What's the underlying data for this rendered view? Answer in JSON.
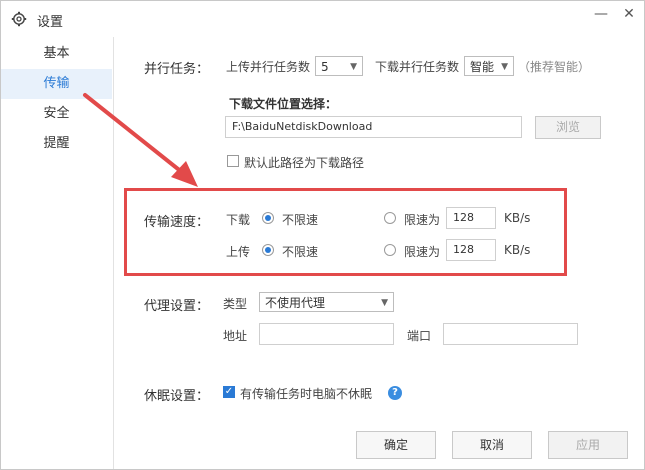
{
  "window": {
    "title": "设置",
    "minimize": "—",
    "close": "✕"
  },
  "sidebar": {
    "items": [
      {
        "label": "基本"
      },
      {
        "label": "传输"
      },
      {
        "label": "安全"
      },
      {
        "label": "提醒"
      }
    ],
    "active": "传输"
  },
  "parallel": {
    "section_label": "并行任务：",
    "upload_label": "上传并行任务数",
    "upload_value": "5",
    "download_label": "下载并行任务数",
    "download_value": "智能",
    "recommend_hint": "（推荐智能）"
  },
  "download_location": {
    "label": "下载文件位置选择：",
    "path": "F:\\BaiduNetdiskDownload",
    "browse_label": "浏览",
    "default_checkbox_label": "默认此路径为下载路径",
    "default_checked": false
  },
  "speed": {
    "section_label": "传输速度：",
    "download": {
      "label": "下载",
      "unlimited": "不限速",
      "limited": "限速为",
      "value": "128",
      "unit": "KB/s",
      "selected": "unlimited"
    },
    "upload": {
      "label": "上传",
      "unlimited": "不限速",
      "limited": "限速为",
      "value": "128",
      "unit": "KB/s",
      "selected": "unlimited"
    }
  },
  "proxy": {
    "section_label": "代理设置：",
    "type_label": "类型",
    "type_value": "不使用代理",
    "address_label": "地址",
    "address_value": "",
    "port_label": "端口",
    "port_value": ""
  },
  "sleep": {
    "section_label": "休眠设置：",
    "checkbox_label": "有传输任务时电脑不休眠",
    "checked": true
  },
  "footer": {
    "ok_label": "确定",
    "cancel_label": "取消",
    "apply_label": "应用"
  },
  "colors": {
    "accent": "#2a7ad5",
    "annotation_red": "#e24a4a",
    "sidebar_active_bg": "#e8f1fb"
  },
  "icons": {
    "title": "gear-icon",
    "help": "help-icon",
    "arrow": "annotation-arrow"
  }
}
